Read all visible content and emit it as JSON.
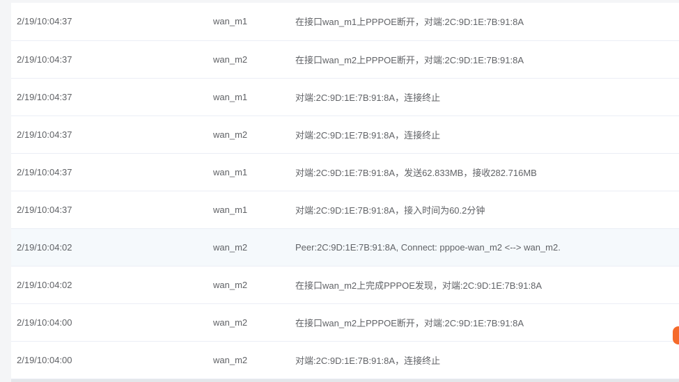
{
  "log": {
    "rows": [
      {
        "time": "2/19/10:04:37",
        "iface": "wan_m1",
        "msg": "在接口wan_m1上PPPOE断开，对端:2C:9D:1E:7B:91:8A"
      },
      {
        "time": "2/19/10:04:37",
        "iface": "wan_m2",
        "msg": "在接口wan_m2上PPPOE断开，对端:2C:9D:1E:7B:91:8A"
      },
      {
        "time": "2/19/10:04:37",
        "iface": "wan_m1",
        "msg": "对端:2C:9D:1E:7B:91:8A，连接终止"
      },
      {
        "time": "2/19/10:04:37",
        "iface": "wan_m2",
        "msg": "对端:2C:9D:1E:7B:91:8A，连接终止"
      },
      {
        "time": "2/19/10:04:37",
        "iface": "wan_m1",
        "msg": "对端:2C:9D:1E:7B:91:8A，发送62.833MB，接收282.716MB"
      },
      {
        "time": "2/19/10:04:37",
        "iface": "wan_m1",
        "msg": "对端:2C:9D:1E:7B:91:8A，接入时间为60.2分钟"
      },
      {
        "time": "2/19/10:04:02",
        "iface": "wan_m2",
        "msg": "Peer:2C:9D:1E:7B:91:8A, Connect: pppoe-wan_m2 <--> wan_m2."
      },
      {
        "time": "2/19/10:04:02",
        "iface": "wan_m2",
        "msg": "在接口wan_m2上完成PPPOE发现，对端:2C:9D:1E:7B:91:8A"
      },
      {
        "time": "2/19/10:04:00",
        "iface": "wan_m2",
        "msg": "在接口wan_m2上PPPOE断开，对端:2C:9D:1E:7B:91:8A"
      },
      {
        "time": "2/19/10:04:00",
        "iface": "wan_m2",
        "msg": "对端:2C:9D:1E:7B:91:8A，连接终止"
      }
    ]
  },
  "colors": {
    "text": "#606266",
    "row_border": "#ebeef5",
    "highlight_row": "#f5f9fc",
    "side_widget": "#f56a2a"
  }
}
